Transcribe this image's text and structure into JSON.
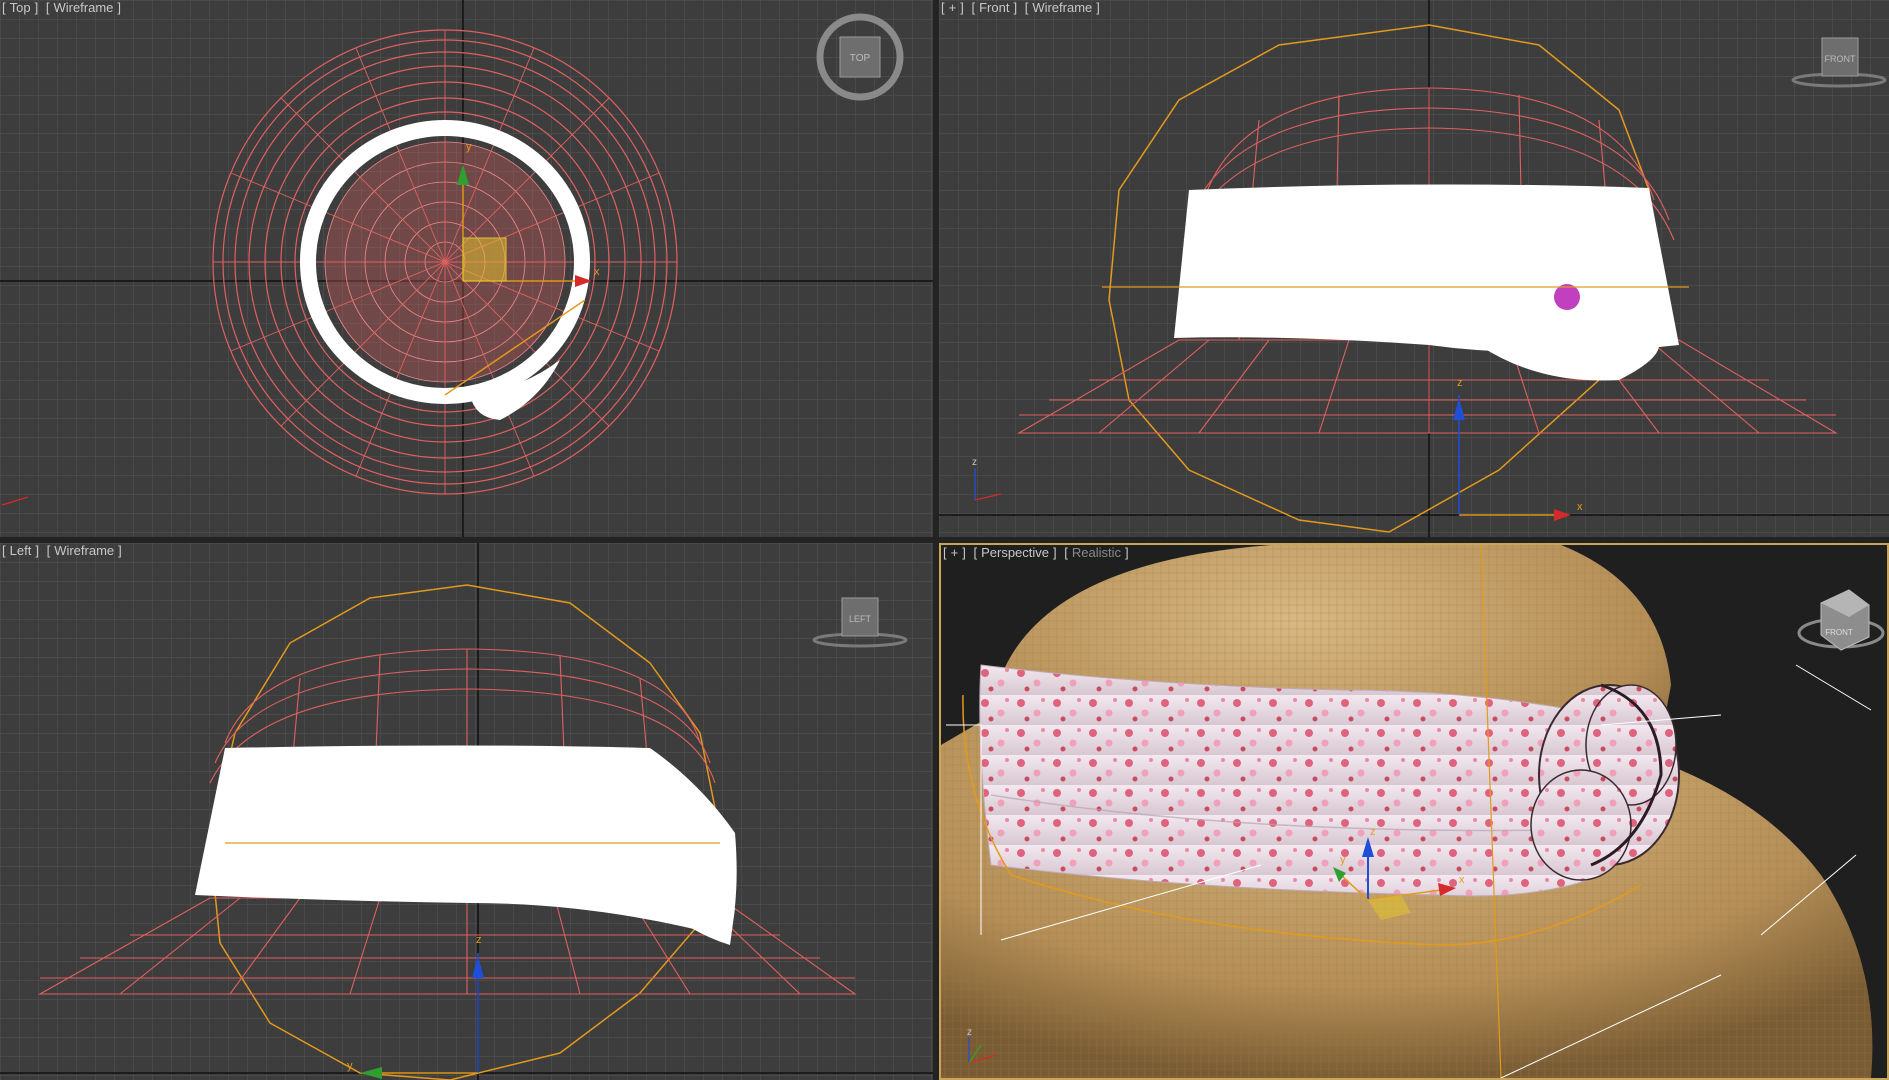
{
  "viewports": {
    "top": {
      "bracket": "Top",
      "shading": "Wireframe",
      "cube_label": "TOP"
    },
    "front": {
      "plus": "+",
      "bracket": "Front",
      "shading": "Wireframe",
      "cube_label": "FRONT"
    },
    "left": {
      "bracket": "Left",
      "shading": "Wireframe",
      "cube_label": "LEFT"
    },
    "persp": {
      "plus": "+",
      "bracket": "Perspective",
      "shading": "Realistic",
      "cube_label": "FRONT"
    }
  },
  "axes": {
    "x": "x",
    "y": "y",
    "z": "z"
  },
  "colors": {
    "viewport_bg": "#3d3d3d",
    "grid": "#555555",
    "wire_hat": "#e06060",
    "wire_band": "#ffffff",
    "selection": "#e39a1c",
    "active_border": "#c9a55a",
    "straw": "#c9a46a",
    "fabric": "#efe6ee",
    "flower": "#e07a9a"
  }
}
